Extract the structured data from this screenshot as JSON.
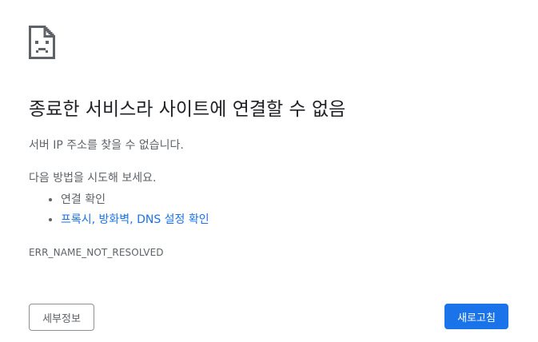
{
  "icon": "sad-page-icon",
  "title": "종료한 서비스라 사이트에 연결할 수 없음",
  "description": "서버 IP 주소를 찾을 수 없습니다.",
  "try_heading": "다음 방법을 시도해 보세요.",
  "suggestions": [
    {
      "label": "연결 확인",
      "is_link": false
    },
    {
      "label": "프록시, 방화벽, DNS 설정 확인",
      "is_link": true
    }
  ],
  "error_code": "ERR_NAME_NOT_RESOLVED",
  "buttons": {
    "details_label": "세부정보",
    "reload_label": "새로고침"
  },
  "colors": {
    "link": "#1a73e8",
    "primary_button": "#1a73e8",
    "text_secondary": "#5f6368",
    "title": "#202124"
  }
}
